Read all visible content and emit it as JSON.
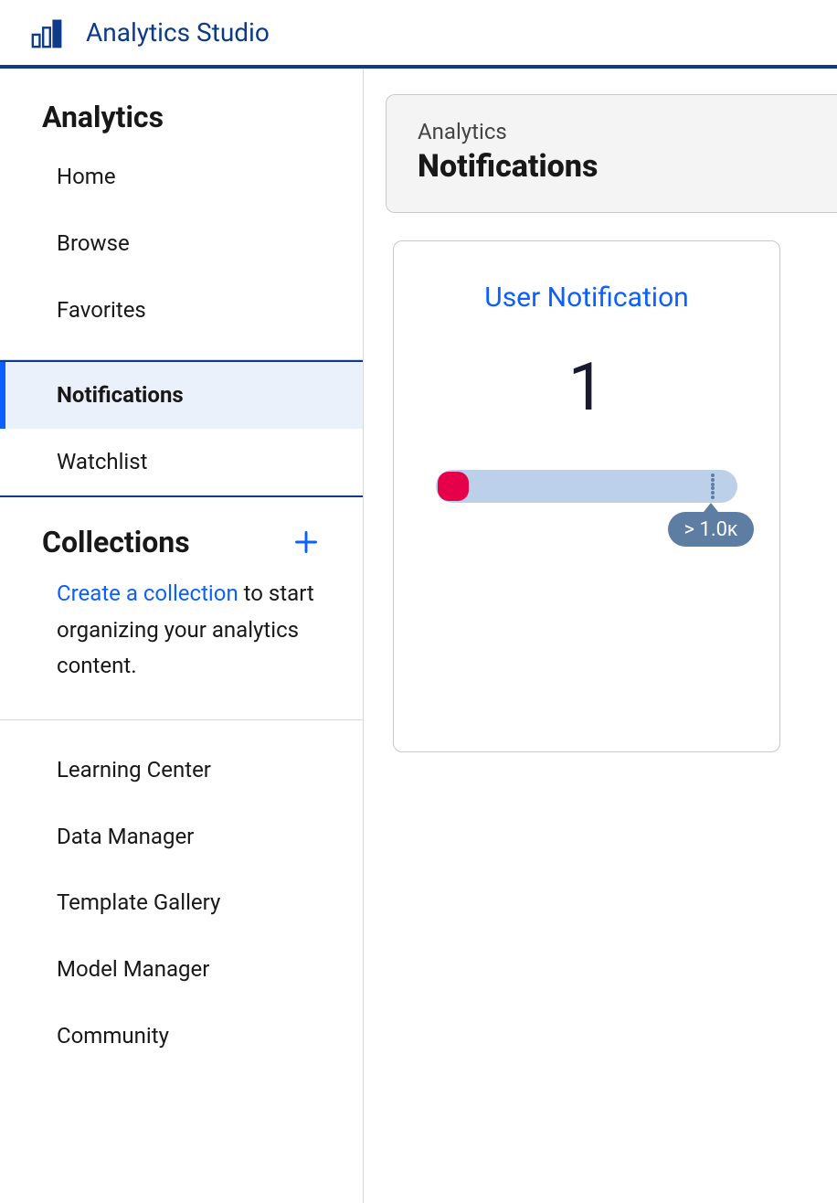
{
  "header": {
    "title": "Analytics Studio"
  },
  "sidebar": {
    "section1": {
      "heading": "Analytics",
      "items": [
        "Home",
        "Browse",
        "Favorites"
      ]
    },
    "section2": {
      "items": [
        "Notifications",
        "Watchlist"
      ],
      "active_index": 0
    },
    "collections": {
      "heading": "Collections",
      "link_text": "Create a collection",
      "desc_rest": " to start organizing your analytics content."
    },
    "section4": {
      "items": [
        "Learning Center",
        "Data Manager",
        "Template Gallery",
        "Model Manager",
        "Community"
      ]
    }
  },
  "main": {
    "eyebrow": "Analytics",
    "title": "Notifications",
    "card": {
      "title": "User Notification",
      "value": "1",
      "gauge_label": "> 1.0ᴋ"
    }
  }
}
